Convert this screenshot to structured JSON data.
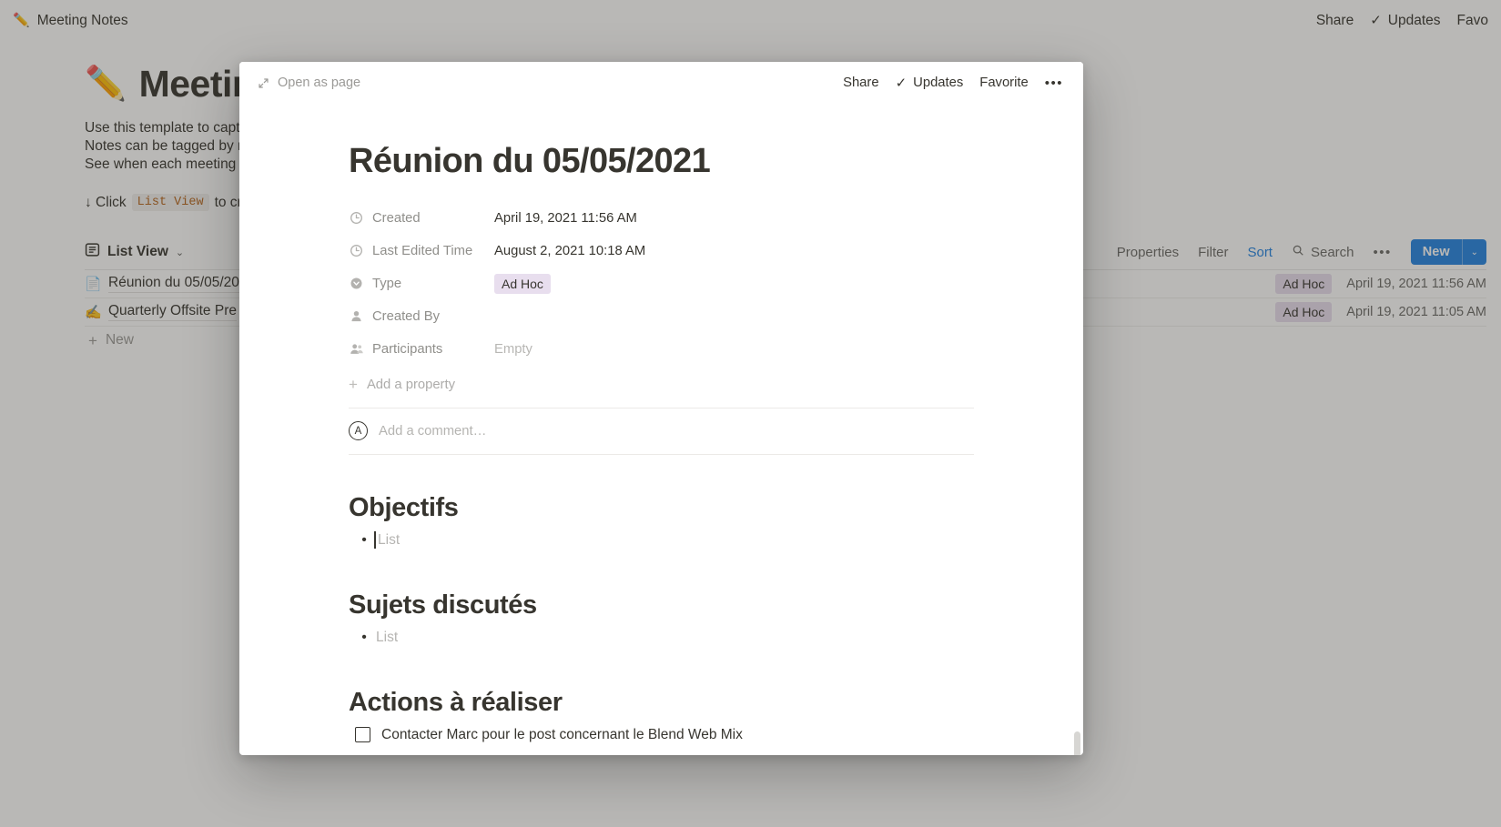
{
  "background": {
    "topbar": {
      "breadcrumb_emoji": "✏️",
      "breadcrumb_label": "Meeting Notes",
      "share_label": "Share",
      "updates_label": "Updates",
      "updates_check": "✓",
      "favorite_label": "Favo"
    },
    "page": {
      "title_emoji": "✏️",
      "title": "Meeting",
      "description_lines": [
        "Use this template to capture",
        "Notes can be tagged by me",
        "See when each meeting too"
      ],
      "callout_prefix": "↓ Click",
      "callout_code": "List View",
      "callout_suffix": "to creat"
    },
    "view": {
      "tab_label": "List View",
      "tab_chevron": "⌄",
      "tools": {
        "properties": "Properties",
        "filter": "Filter",
        "sort": "Sort",
        "search": "Search",
        "more": "•••"
      },
      "new_button": "New",
      "new_caret": "⌄"
    },
    "rows": [
      {
        "icon": "📄",
        "title": "Réunion du 05/05/20",
        "tag": "Ad Hoc",
        "date": "April 19, 2021 11:56 AM"
      },
      {
        "icon": "✍️",
        "title": "Quarterly Offsite Pre",
        "tag": "Ad Hoc",
        "date": "April 19, 2021 11:05 AM"
      }
    ],
    "add_new_label": "New",
    "add_new_plus": "+"
  },
  "modal": {
    "header": {
      "open_as_page": "Open as page",
      "share_label": "Share",
      "updates_check": "✓",
      "updates_label": "Updates",
      "favorite_label": "Favorite",
      "more_label": "•••"
    },
    "title": "Réunion du 05/05/2021",
    "properties": [
      {
        "icon": "clock",
        "name": "Created",
        "value": "April 19, 2021 11:56 AM",
        "empty": false
      },
      {
        "icon": "clock",
        "name": "Last Edited Time",
        "value": "August 2, 2021 10:18 AM",
        "empty": false
      },
      {
        "icon": "select",
        "name": "Type",
        "value": "Ad Hoc",
        "tag": true
      },
      {
        "icon": "person",
        "name": "Created By",
        "value": "",
        "empty": false
      },
      {
        "icon": "people",
        "name": "Participants",
        "value": "Empty",
        "empty": true
      }
    ],
    "add_property_label": "Add a property",
    "add_property_plus": "+",
    "comment": {
      "avatar_letter": "A",
      "placeholder": "Add a comment…"
    },
    "sections": [
      {
        "heading": "Objectifs",
        "bullets": [
          {
            "text": "List",
            "caret": true
          }
        ]
      },
      {
        "heading": "Sujets discutés",
        "bullets": [
          {
            "text": "List",
            "caret": false
          }
        ]
      },
      {
        "heading": "Actions à réaliser",
        "todos": [
          {
            "text": "Contacter Marc pour le post concernant le Blend Web Mix",
            "checked": false
          }
        ]
      }
    ]
  },
  "colors": {
    "accent_blue": "#2383e2",
    "tag_purple_bg": "#e8deee",
    "text_primary": "#37352f",
    "text_muted": "#9b9a97"
  }
}
